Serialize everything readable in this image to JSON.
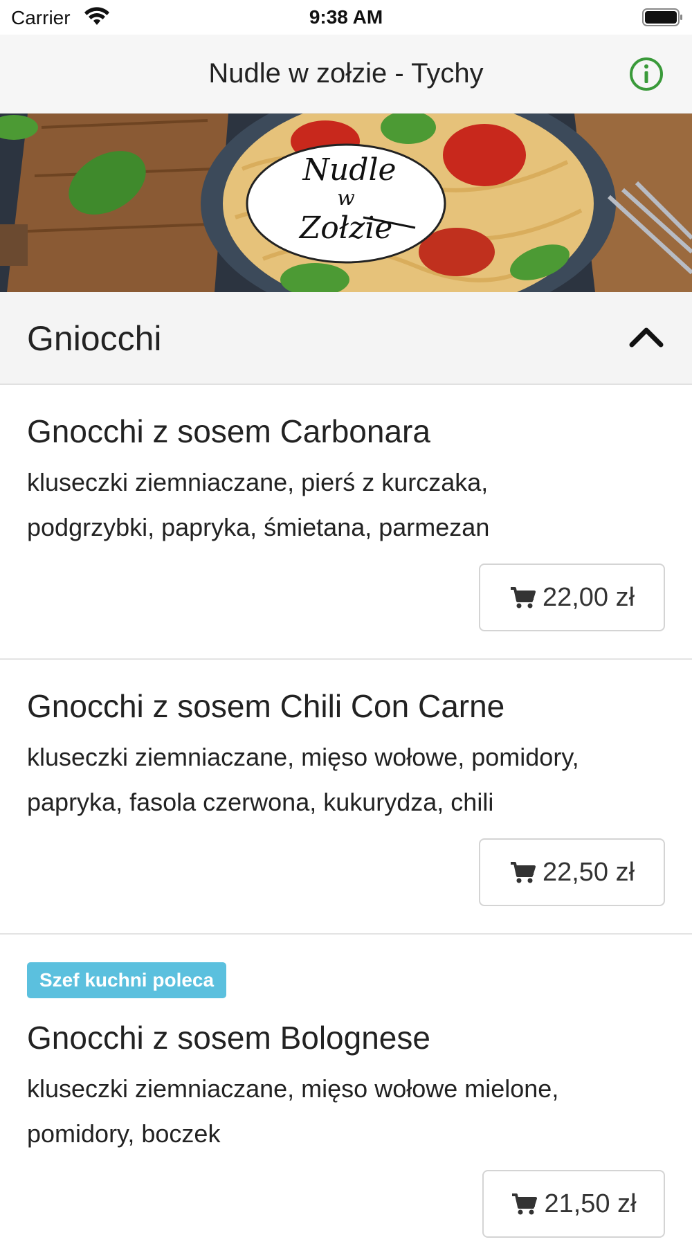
{
  "status_bar": {
    "carrier": "Carrier",
    "time": "9:38 AM"
  },
  "nav": {
    "title": "Nudle w zołzie - Tychy",
    "info_icon": "info-circle-icon",
    "accent_color": "#3a9a3a"
  },
  "banner": {
    "logo_text_line1": "Nudle",
    "logo_text_line2": "w",
    "logo_text_line3": "Zołzie"
  },
  "section": {
    "title": "Gniocchi",
    "toggle_icon": "chevron-up-icon"
  },
  "items": [
    {
      "name": "Gnocchi z sosem Carbonara",
      "desc_line1": "kluseczki ziemniaczane, pierś z kurczaka,",
      "desc_line2": "podgrzybki, papryka, śmietana, parmezan",
      "price": "22,00 zł",
      "badge": ""
    },
    {
      "name": "Gnocchi z sosem Chili Con Carne",
      "desc_line1": "kluseczki ziemniaczane, mięso wołowe, pomidory,",
      "desc_line2": "papryka, fasola czerwona, kukurydza, chili",
      "price": "22,50 zł",
      "badge": ""
    },
    {
      "name": "Gnocchi z sosem Bolognese",
      "desc_line1": "kluseczki ziemniaczane, mięso wołowe mielone,",
      "desc_line2": "pomidory, boczek",
      "price": "21,50 zł",
      "badge": "Szef kuchni poleca",
      "badge_color": "#5bc0de"
    }
  ]
}
